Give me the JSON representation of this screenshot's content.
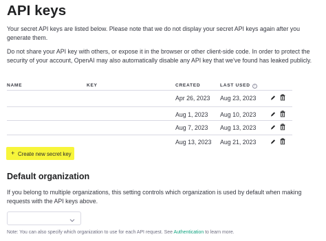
{
  "page": {
    "title": "API keys",
    "intro": "Your secret API keys are listed below. Please note that we do not display your secret API keys again after you generate them.",
    "warning": "Do not share your API key with others, or expose it in the browser or other client-side code. In order to protect the security of your account, OpenAI may also automatically disable any API key that we've found has leaked publicly."
  },
  "table": {
    "headers": {
      "name": "NAME",
      "key": "KEY",
      "created": "CREATED",
      "last_used": "LAST USED"
    },
    "rows": [
      {
        "created": "Apr 26, 2023",
        "last_used": "Aug 23, 2023"
      },
      {
        "created": "Aug 1, 2023",
        "last_used": "Aug 10, 2023"
      },
      {
        "created": "Aug 7, 2023",
        "last_used": "Aug 13, 2023"
      },
      {
        "created": "Aug 13, 2023",
        "last_used": "Aug 21, 2023"
      }
    ],
    "icons": {
      "info": "info-icon",
      "edit": "pencil-icon",
      "delete": "trash-icon"
    }
  },
  "create_button": {
    "icon": "plus-icon",
    "label": "Create new secret key",
    "highlight_color": "#f7f53a"
  },
  "default_org": {
    "title": "Default organization",
    "description": "If you belong to multiple organizations, this setting controls which organization is used by default when making requests with the API keys above.",
    "select_value": "",
    "note_prefix": "Note: You can also specify which organization to use for each API request. See ",
    "note_link": "Authentication",
    "note_suffix": " to learn more."
  },
  "colors": {
    "link": "#10a37f",
    "text": "#353740",
    "rule": "#d9d9e3"
  }
}
